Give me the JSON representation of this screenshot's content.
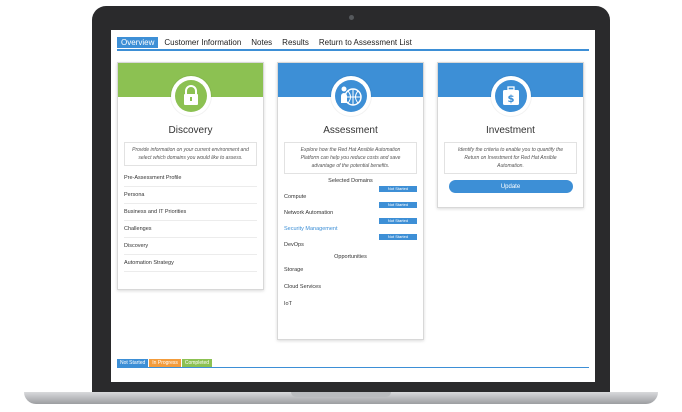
{
  "tabs": [
    {
      "label": "Overview"
    },
    {
      "label": "Customer Information"
    },
    {
      "label": "Notes"
    },
    {
      "label": "Results"
    },
    {
      "label": "Return to Assessment List"
    }
  ],
  "colors": {
    "discovery": "#8cc152",
    "assessment": "#3d8fd6",
    "investment": "#3d8fd6"
  },
  "discovery": {
    "title": "Discovery",
    "icon": "lock-icon",
    "description": "Provide information on your current environment and select which domains you would like to assess.",
    "items": [
      {
        "label": "Pre-Assessment Profile"
      },
      {
        "label": "Persona"
      },
      {
        "label": "Business and IT Priorities"
      },
      {
        "label": "Challenges"
      },
      {
        "label": "Discovery"
      },
      {
        "label": "Automation Strategy"
      }
    ]
  },
  "assessment": {
    "title": "Assessment",
    "icon": "globe-person-icon",
    "description": "Explore how the Red Hat Ansible Automation Platform can help you reduce costs and save advantage of the potential benefits.",
    "selected_domains_title": "Selected Domains",
    "domains": [
      {
        "label": "Compute",
        "status": "Not Started"
      },
      {
        "label": "Network Automation",
        "status": "Not Started"
      },
      {
        "label": "Security Management",
        "status": "Not Started"
      },
      {
        "label": "DevOps",
        "status": "Not Started"
      }
    ],
    "opportunities_title": "Opportunities",
    "opportunities": [
      {
        "label": "Storage"
      },
      {
        "label": "Cloud Services"
      },
      {
        "label": "IoT"
      }
    ]
  },
  "investment": {
    "title": "Investment",
    "icon": "briefcase-dollar-icon",
    "description": "Identify the criteria to enable you to quantify the Return on Investment for Red Hat Ansible Automation.",
    "button_label": "Update"
  },
  "legend": [
    {
      "label": "Not Started",
      "color": "#3d8fd6"
    },
    {
      "label": "In Progress",
      "color": "#f39c3c"
    },
    {
      "label": "Completed",
      "color": "#8cc152"
    }
  ]
}
